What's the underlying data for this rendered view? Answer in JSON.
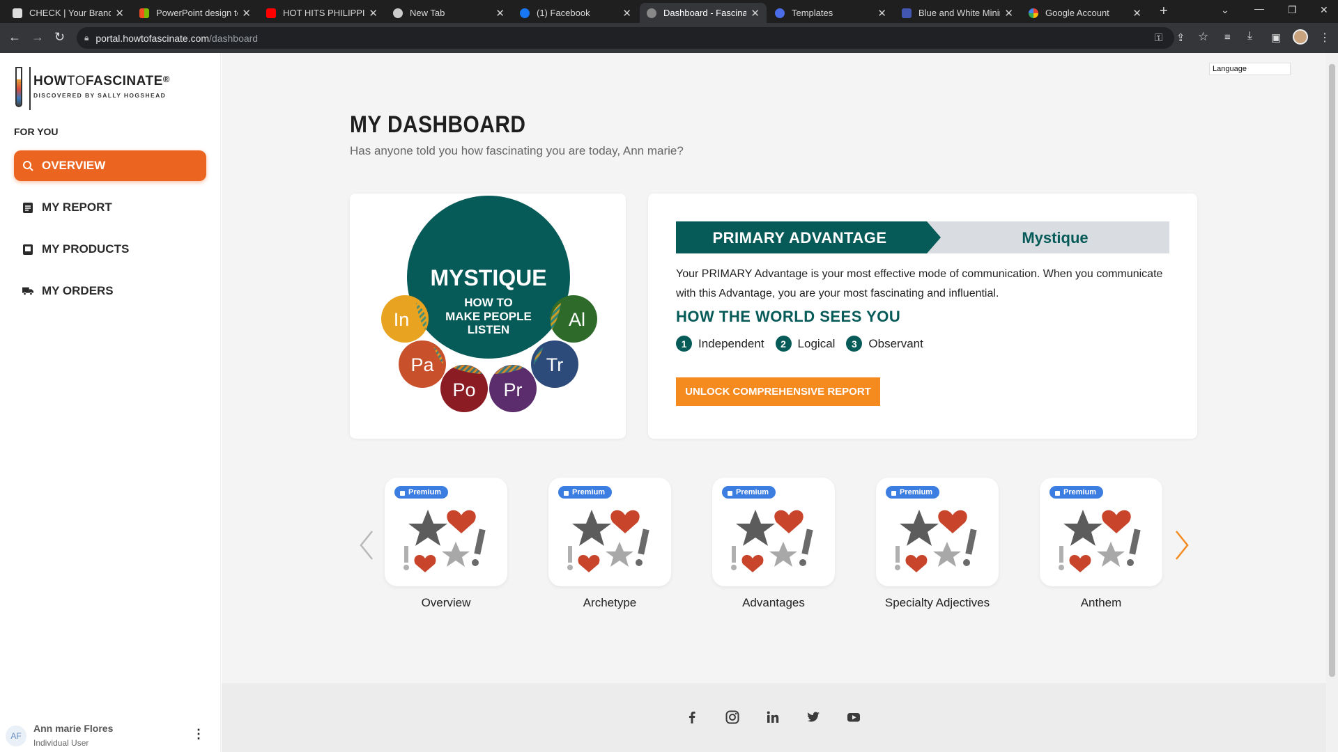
{
  "browser": {
    "tabs": [
      {
        "title": "CHECK | Your Brandin",
        "color": "#3b3b3b"
      },
      {
        "title": "PowerPoint design te",
        "color": "#d24726"
      },
      {
        "title": "HOT HITS PHILIPPINE",
        "color": "#ff0000"
      },
      {
        "title": "New Tab",
        "color": "#9aa0a6"
      },
      {
        "title": "(1) Facebook",
        "color": "#1877f2"
      },
      {
        "title": "Dashboard - Fascinat",
        "color": "#9aa0a6"
      },
      {
        "title": "Templates",
        "color": "#4b6ee8"
      },
      {
        "title": "Blue and White Minir",
        "color": "#4257b2"
      },
      {
        "title": "Google Account",
        "color": "#ffffff"
      }
    ],
    "active_tab": 5,
    "url_host": "portal.howtofascinate.com",
    "url_path": "/dashboard"
  },
  "sidebar": {
    "logo_main_a": "HOW",
    "logo_main_b": "TO",
    "logo_main_c": "FASCINATE",
    "logo_reg": "®",
    "logo_sub": "DISCOVERED BY SALLY HOGSHEAD",
    "section": "FOR YOU",
    "nav": [
      {
        "label": "OVERVIEW",
        "icon": "search-icon",
        "active": true
      },
      {
        "label": "MY REPORT",
        "icon": "report-icon",
        "active": false
      },
      {
        "label": "MY PRODUCTS",
        "icon": "products-icon",
        "active": false
      },
      {
        "label": "MY ORDERS",
        "icon": "truck-icon",
        "active": false
      }
    ],
    "user": {
      "initials": "AF",
      "name": "Ann marie Flores",
      "role": "Individual User"
    }
  },
  "header": {
    "language": "Language",
    "title": "MY DASHBOARD",
    "greeting": "Has anyone told you how fascinating you are today, Ann marie?"
  },
  "archetype": {
    "name": "MYSTIQUE",
    "tagline_1": "HOW TO",
    "tagline_2": "MAKE PEOPLE",
    "tagline_3": "LISTEN",
    "bubbles": [
      {
        "label": "In",
        "color": "#e8a320"
      },
      {
        "label": "Pa",
        "color": "#c8502b"
      },
      {
        "label": "Po",
        "color": "#8b1c24"
      },
      {
        "label": "Pr",
        "color": "#5b2d6c"
      },
      {
        "label": "Tr",
        "color": "#2c4a7a"
      },
      {
        "label": "Al",
        "color": "#2e6b2a"
      }
    ],
    "main_color": "#065a58"
  },
  "advantage": {
    "banner_label": "PRIMARY ADVANTAGE",
    "banner_value": "Mystique",
    "description": "Your PRIMARY Advantage is your most effective mode of communication. When you communicate with this Advantage, you are your most fascinating and influential.",
    "world_heading": "HOW THE WORLD SEES YOU",
    "traits": [
      {
        "num": "1",
        "label": "Independent"
      },
      {
        "num": "2",
        "label": "Logical"
      },
      {
        "num": "3",
        "label": "Observant"
      }
    ],
    "unlock_button": "UNLOCK COMPREHENSIVE REPORT"
  },
  "products": {
    "badge": "Premium",
    "items": [
      {
        "label": "Overview"
      },
      {
        "label": "Archetype"
      },
      {
        "label": "Advantages"
      },
      {
        "label": "Specialty Adjectives"
      },
      {
        "label": "Anthem"
      }
    ]
  },
  "footer": {
    "social": [
      "facebook-icon",
      "instagram-icon",
      "linkedin-icon",
      "twitter-icon",
      "youtube-icon"
    ]
  }
}
